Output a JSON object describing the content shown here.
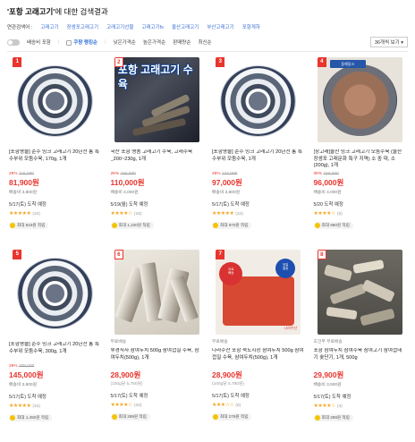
{
  "header": {
    "keyword": "'포항 고래고기'",
    "title_suffix": "에 대한 검색결과"
  },
  "related": {
    "label": "연관검색어 :",
    "items": [
      "고래고기",
      "장생포고래고기",
      "고래고기선물",
      "고래고기fs",
      "울산고래고기",
      "부산고래고기",
      "포항게하"
    ]
  },
  "filters": {
    "toggle_label": "배송비 포함",
    "rocket_label": "쿠팡 랭킹순",
    "sort_options": [
      "낮은가격순",
      "높은가격순",
      "판매량순",
      "최신순"
    ],
    "view_select": "36개씩 보기"
  },
  "products": [
    {
      "rank": "1",
      "name": "[포항명물] 순수 밍크 고래고기 20년전 통 특수부위 모둠수육, 170g, 1개",
      "badge": "",
      "discount_pct": "29%",
      "orig_price": "115,000",
      "price": "81,900원",
      "unit_price": "",
      "shipping": "배송비 3,800원",
      "eta": "5/17(토) 도착 예정",
      "stars": "★★★★★",
      "reviews": "(34)",
      "reward": "최대 819원 적립"
    },
    {
      "rank": "2",
      "image_text": "포항 고래고기 수육",
      "name": "국산 포항 명품 고래고기 수육, 고래수육_200~230g, 1개",
      "badge": "",
      "discount_pct": "26%",
      "orig_price": "150,000",
      "price": "110,000원",
      "unit_price": "",
      "shipping": "배송비 4,000원",
      "eta": "5/19(월) 도착 예정",
      "stars": "★★★★☆",
      "reviews": "(16)",
      "reward": "최대 1,100원 적립"
    },
    {
      "rank": "3",
      "name": "[포항명물] 순수 밍크 고래고기 20년전 통 특수부위 모둠수육, 1개",
      "badge": "",
      "discount_pct": "29%",
      "orig_price": "137,000",
      "price": "97,000원",
      "unit_price": "",
      "shipping": "배송비 3,800원",
      "eta": "5/17(토) 도착 예정",
      "stars": "★★★★★",
      "reviews": "(34)",
      "reward": "최대 970원 적립"
    },
    {
      "rank": "4",
      "image_text": "동해밍크",
      "name": "[장고래]울산 밍크 고래고기 모둠수육 (울산 장생포 고래문화 특구 지역) 소 중 대, 소(200g), 1개",
      "badge": "",
      "discount_pct": "36%",
      "orig_price": "150,000",
      "price": "96,000원",
      "unit_price": "",
      "shipping": "배송비 4,000원",
      "eta": "5/20 도착 예정",
      "stars": "★★★★☆",
      "reviews": "(5)",
      "reward": "최대 960원 적립"
    },
    {
      "rank": "5",
      "name": "[포항명물] 순수 밍크 고래고기 20년전 통 특수부위 모둠수육, 300g, 1개",
      "badge": "",
      "discount_pct": "29%",
      "orig_price": "205,000",
      "price": "145,000원",
      "unit_price": "",
      "shipping": "배송비 3,800원",
      "eta": "5/17(토) 도착 예정",
      "stars": "★★★★★",
      "reviews": "(34)",
      "reward": "최대 1,450원 적립"
    },
    {
      "rank": "6",
      "name": "부경직사 삼여두치 500g 삼여껍질 수육, 삼여두치(500g), 1개",
      "badge": "무료배송",
      "discount_pct": "",
      "orig_price": "",
      "price": "28,900원",
      "unit_price": "(100g당 5,780원)",
      "shipping": "",
      "eta": "5/17(토) 도착 예정",
      "stars": "★★★★☆",
      "reviews": "(33)",
      "reward": "최대 289원 적립"
    },
    {
      "rank": "7",
      "image_text": "나라수산",
      "name": "나라수산 포항 죽도시장 삼여두치 500g 삼여껍질 수육, 삼여두치(500g), 1개",
      "badge": "무료배송",
      "discount_pct": "",
      "orig_price": "",
      "price": "28,900원",
      "unit_price": "(100g당 5,780원)",
      "shipping": "",
      "eta": "5/17(토) 도착 예정",
      "stars": "★★★☆☆",
      "reviews": "(6)",
      "reward": "최대 279원 적립"
    },
    {
      "rank": "8",
      "name": "포항 삼여두치 삼여수육 삼여고기 삼여껍데기 숯단기, 1개, 500g",
      "badge": "조건부 무료배송",
      "discount_pct": "",
      "orig_price": "",
      "price": "29,900원",
      "unit_price": "",
      "shipping": "배송비 3,500원",
      "eta": "5/17(토) 도착 예정",
      "stars": "★★★★☆",
      "reviews": "(4)",
      "reward": "최대 299원 적립"
    }
  ],
  "colors": {
    "accent_red": "#e8352e",
    "link_blue": "#3a6fd6",
    "star": "#f5a623"
  }
}
